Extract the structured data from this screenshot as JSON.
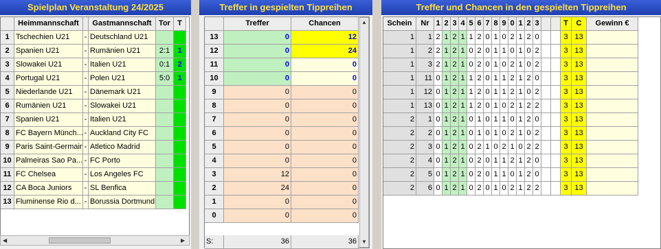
{
  "schedule": {
    "title": "Spielplan Veranstaltung 24/2025",
    "headers": {
      "home": "Heimmannschaft",
      "away": "Gastmannschaft",
      "score": "Tor",
      "tip": "T"
    },
    "rows": [
      {
        "n": "1",
        "home": "Tschechien U21",
        "sep": "-",
        "away": "Deutschland U21",
        "score": "",
        "tip": ""
      },
      {
        "n": "2",
        "home": "Spanien U21",
        "sep": "-",
        "away": "Rumänien U21",
        "score": "2:1",
        "tip": "1"
      },
      {
        "n": "3",
        "home": "Slowakei U21",
        "sep": "-",
        "away": "Italien U21",
        "score": "0:1",
        "tip": "2"
      },
      {
        "n": "4",
        "home": "Portugal U21",
        "sep": "-",
        "away": "Polen U21",
        "score": "5:0",
        "tip": "1"
      },
      {
        "n": "5",
        "home": "Niederlande U21",
        "sep": "-",
        "away": "Dänemark U21",
        "score": "",
        "tip": ""
      },
      {
        "n": "6",
        "home": "Rumänien U21",
        "sep": "-",
        "away": "Slowakei U21",
        "score": "",
        "tip": ""
      },
      {
        "n": "7",
        "home": "Spanien U21",
        "sep": "-",
        "away": "Italien U21",
        "score": "",
        "tip": ""
      },
      {
        "n": "8",
        "home": "FC Bayern Münch...",
        "sep": "-",
        "away": "Auckland City FC",
        "score": "",
        "tip": ""
      },
      {
        "n": "9",
        "home": "Paris Saint-Germain",
        "sep": "-",
        "away": "Atletico Madrid",
        "score": "",
        "tip": ""
      },
      {
        "n": "10",
        "home": "Palmeiras Sao Pa...",
        "sep": "-",
        "away": "FC Porto",
        "score": "",
        "tip": ""
      },
      {
        "n": "11",
        "home": "FC Chelsea",
        "sep": "-",
        "away": "Los Angeles FC",
        "score": "",
        "tip": ""
      },
      {
        "n": "12",
        "home": "CA Boca Juniors",
        "sep": "-",
        "away": "SL Benfica",
        "score": "",
        "tip": ""
      },
      {
        "n": "13",
        "home": "Fluminense Rio d...",
        "sep": "-",
        "away": "Borussia Dortmund",
        "score": "",
        "tip": ""
      }
    ]
  },
  "hits": {
    "title": "Treffer in gespielten Tippreihen",
    "headers": {
      "hits": "Treffer",
      "chances": "Chancen"
    },
    "rows": [
      {
        "n": "13",
        "hits": "0",
        "chances": "12"
      },
      {
        "n": "12",
        "hits": "0",
        "chances": "24"
      },
      {
        "n": "11",
        "hits": "0",
        "chances": "0"
      },
      {
        "n": "10",
        "hits": "0",
        "chances": "0"
      },
      {
        "n": "9",
        "hits": "0",
        "chances": "0"
      },
      {
        "n": "8",
        "hits": "0",
        "chances": "0"
      },
      {
        "n": "7",
        "hits": "0",
        "chances": "0"
      },
      {
        "n": "6",
        "hits": "0",
        "chances": "0"
      },
      {
        "n": "5",
        "hits": "0",
        "chances": "0"
      },
      {
        "n": "4",
        "hits": "0",
        "chances": "0"
      },
      {
        "n": "3",
        "hits": "12",
        "chances": "0"
      },
      {
        "n": "2",
        "hits": "24",
        "chances": "0"
      },
      {
        "n": "1",
        "hits": "0",
        "chances": "0"
      },
      {
        "n": "0",
        "hits": "0",
        "chances": "0"
      }
    ],
    "sum_label": "S:",
    "sum_hits": "36",
    "sum_chances": "36"
  },
  "tips": {
    "title": "Treffer und Chancen in den gespielten Tippreihen",
    "headers": {
      "schein": "Schein",
      "nr": "Nr",
      "cols": [
        "1",
        "2",
        "3",
        "4",
        "5",
        "6",
        "7",
        "8",
        "9",
        "0",
        "1",
        "2",
        "3"
      ],
      "t": "T",
      "c": "C",
      "gain": "Gewinn €"
    },
    "rows": [
      {
        "schein": "1",
        "nr": "1",
        "tips": [
          "2",
          "1",
          "2",
          "1",
          "1",
          "2",
          "0",
          "1",
          "0",
          "2",
          "1",
          "2",
          "0"
        ],
        "t": "3",
        "c": "13"
      },
      {
        "schein": "1",
        "nr": "2",
        "tips": [
          "2",
          "1",
          "2",
          "1",
          "0",
          "2",
          "0",
          "1",
          "1",
          "0",
          "1",
          "0",
          "2"
        ],
        "t": "3",
        "c": "13"
      },
      {
        "schein": "1",
        "nr": "3",
        "tips": [
          "2",
          "1",
          "2",
          "1",
          "0",
          "2",
          "0",
          "1",
          "0",
          "2",
          "1",
          "0",
          "2"
        ],
        "t": "3",
        "c": "13"
      },
      {
        "schein": "1",
        "nr": "11",
        "tips": [
          "0",
          "1",
          "2",
          "1",
          "1",
          "2",
          "0",
          "1",
          "1",
          "2",
          "1",
          "2",
          "0"
        ],
        "t": "3",
        "c": "13"
      },
      {
        "schein": "1",
        "nr": "12",
        "tips": [
          "0",
          "1",
          "2",
          "1",
          "1",
          "2",
          "0",
          "1",
          "1",
          "2",
          "1",
          "0",
          "2"
        ],
        "t": "3",
        "c": "13"
      },
      {
        "schein": "1",
        "nr": "13",
        "tips": [
          "0",
          "1",
          "2",
          "1",
          "1",
          "2",
          "0",
          "1",
          "0",
          "2",
          "1",
          "2",
          "2"
        ],
        "t": "3",
        "c": "13"
      },
      {
        "schein": "2",
        "nr": "1",
        "tips": [
          "0",
          "1",
          "2",
          "1",
          "0",
          "1",
          "0",
          "1",
          "1",
          "0",
          "1",
          "2",
          "0"
        ],
        "t": "3",
        "c": "13"
      },
      {
        "schein": "2",
        "nr": "2",
        "tips": [
          "0",
          "1",
          "2",
          "1",
          "0",
          "1",
          "0",
          "1",
          "0",
          "2",
          "1",
          "0",
          "2"
        ],
        "t": "3",
        "c": "13"
      },
      {
        "schein": "2",
        "nr": "3",
        "tips": [
          "0",
          "1",
          "2",
          "1",
          "0",
          "2",
          "1",
          "0",
          "2",
          "1",
          "0",
          "2",
          "2"
        ],
        "t": "3",
        "c": "13"
      },
      {
        "schein": "2",
        "nr": "4",
        "tips": [
          "0",
          "1",
          "2",
          "1",
          "0",
          "2",
          "0",
          "1",
          "1",
          "2",
          "1",
          "2",
          "0"
        ],
        "t": "3",
        "c": "13"
      },
      {
        "schein": "2",
        "nr": "5",
        "tips": [
          "0",
          "1",
          "2",
          "1",
          "0",
          "2",
          "0",
          "1",
          "1",
          "0",
          "1",
          "2",
          "0"
        ],
        "t": "3",
        "c": "13"
      },
      {
        "schein": "2",
        "nr": "6",
        "tips": [
          "0",
          "1",
          "2",
          "1",
          "0",
          "2",
          "0",
          "1",
          "0",
          "2",
          "1",
          "2",
          "2"
        ],
        "t": "3",
        "c": "13"
      }
    ]
  },
  "colors": {
    "green": "#c8f0c8",
    "bright_green": "#00e000",
    "yellow": "#ffff00",
    "pale_yellow": "#ffffe0",
    "peach": "#fde0c8",
    "light_green": "#c0f0c0"
  },
  "scrollbar": {
    "left_icon": "scroll-left-icon",
    "right_icon": "scroll-right-icon",
    "up_icon": "scroll-up-icon",
    "down_icon": "scroll-down-icon"
  }
}
